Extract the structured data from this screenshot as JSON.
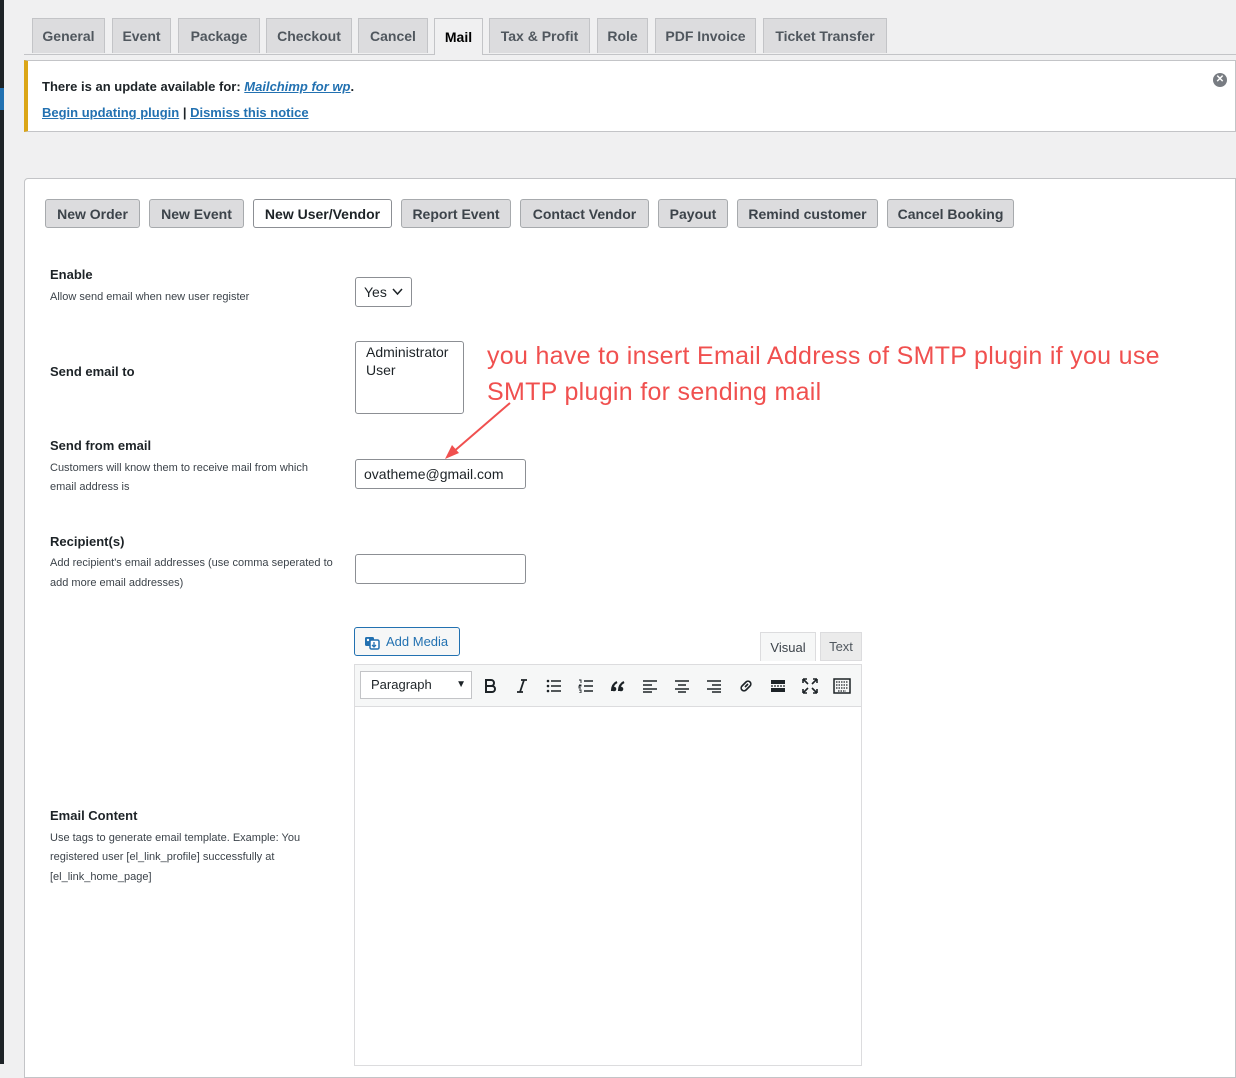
{
  "nav_tabs": [
    {
      "label": "General"
    },
    {
      "label": "Event"
    },
    {
      "label": "Package"
    },
    {
      "label": "Checkout"
    },
    {
      "label": "Cancel"
    },
    {
      "label": "Mail",
      "active": true
    },
    {
      "label": "Tax & Profit"
    },
    {
      "label": "Role"
    },
    {
      "label": "PDF Invoice"
    },
    {
      "label": "Ticket Transfer"
    }
  ],
  "notice": {
    "text": "There is an update available for: ",
    "plugin_link": "Mailchimp for wp",
    "period": ".",
    "begin_link": "Begin updating plugin",
    "separator": " | ",
    "dismiss_link": "Dismiss this notice",
    "accent_color": "#dba617"
  },
  "mail_tabs": [
    {
      "label": "New Order"
    },
    {
      "label": "New Event"
    },
    {
      "label": "New User/Vendor",
      "active": true
    },
    {
      "label": "Report Event"
    },
    {
      "label": "Contact Vendor"
    },
    {
      "label": "Payout"
    },
    {
      "label": "Remind customer"
    },
    {
      "label": "Cancel Booking"
    }
  ],
  "fields": {
    "enable": {
      "title": "Enable",
      "desc": "Allow send email when new user register",
      "value": "Yes"
    },
    "send_to": {
      "title": "Send email to",
      "options": [
        "Administrator",
        "User"
      ]
    },
    "send_from": {
      "title": "Send from email",
      "desc_line1": "Customers will know them to receive mail from which",
      "desc_line2": "email address is",
      "value": "ovatheme@gmail.com"
    },
    "recipients": {
      "title": "Recipient(s)",
      "desc_line1": "Add recipient's email addresses (use comma seperated to",
      "desc_line2": "add more email addresses)",
      "value": ""
    },
    "email_content": {
      "title": "Email Content",
      "desc_line1": "Use tags to generate email template. Example: You",
      "desc_line2": "registered user [el_link_profile] successfully at",
      "desc_line3": "[el_link_home_page]"
    }
  },
  "editor": {
    "add_media_label": "Add Media",
    "tab_visual": "Visual",
    "tab_text": "Text",
    "format_value": "Paragraph",
    "toolbar_icons": [
      "bold-icon",
      "italic-icon",
      "bullet-list-icon",
      "numbered-list-icon",
      "blockquote-icon",
      "align-left-icon",
      "align-center-icon",
      "align-right-icon",
      "link-icon",
      "read-more-icon",
      "fullscreen-icon",
      "toolbar-toggle-icon"
    ]
  },
  "annotation": {
    "line1": "you have to insert Email Address of SMTP plugin if you use",
    "line2": "SMTP plugin for sending mail",
    "color": "#f0504f"
  }
}
